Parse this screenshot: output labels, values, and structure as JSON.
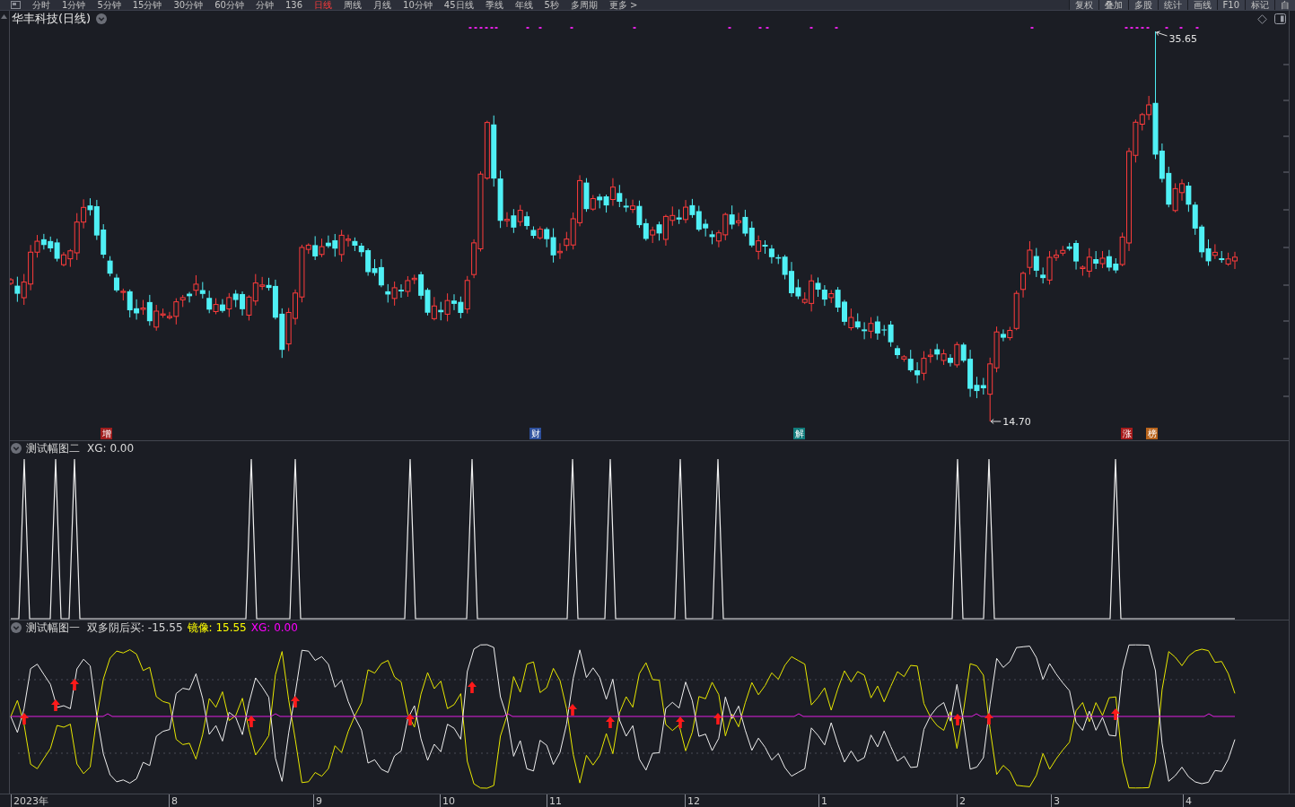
{
  "toolbar": {
    "periods": [
      {
        "label": "分时",
        "selected": false
      },
      {
        "label": "1分钟",
        "selected": false
      },
      {
        "label": "5分钟",
        "selected": false
      },
      {
        "label": "15分钟",
        "selected": false
      },
      {
        "label": "30分钟",
        "selected": false
      },
      {
        "label": "60分钟",
        "selected": false
      },
      {
        "label": "分钟",
        "selected": false
      },
      {
        "label": "136",
        "selected": false
      },
      {
        "label": "日线",
        "selected": true
      },
      {
        "label": "周线",
        "selected": false
      },
      {
        "label": "月线",
        "selected": false
      },
      {
        "label": "10分钟",
        "selected": false
      },
      {
        "label": "45日线",
        "selected": false
      },
      {
        "label": "季线",
        "selected": false
      },
      {
        "label": "年线",
        "selected": false
      },
      {
        "label": "5秒",
        "selected": false
      },
      {
        "label": "多周期",
        "selected": false
      },
      {
        "label": "更多 >",
        "selected": false
      }
    ],
    "tools": [
      "复权",
      "叠加",
      "多股",
      "统计",
      "画线",
      "F10",
      "标记",
      "自"
    ]
  },
  "main_chart": {
    "title": "华丰科技(日线)",
    "high_label": "35.65",
    "low_label": "14.70",
    "events": [
      {
        "label": "增",
        "color": "#a01e1e"
      },
      {
        "label": "财",
        "color": "#2d4f9c"
      },
      {
        "label": "解",
        "color": "#127c7c"
      },
      {
        "label": "涨",
        "color": "#a81c1c"
      },
      {
        "label": "榜",
        "color": "#b8641c"
      }
    ]
  },
  "indicator_panels": [
    {
      "kind": "spike",
      "name": "测试幅图二",
      "readings": [
        {
          "text": "XG: 0.00"
        }
      ]
    },
    {
      "kind": "oscillator",
      "name": "测试幅图一",
      "readings": [
        {
          "text": "双多阴后买: -15.55",
          "color": "#d8d8d8"
        },
        {
          "text": "镜像: 15.55",
          "color": "#ffff00"
        },
        {
          "text": "XG: 0.00",
          "color": "#ff00ff"
        }
      ]
    }
  ],
  "time_axis": {
    "labels": [
      "2023年",
      "8",
      "9",
      "10",
      "11",
      "12",
      "1",
      "2",
      "3",
      "4"
    ]
  }
}
